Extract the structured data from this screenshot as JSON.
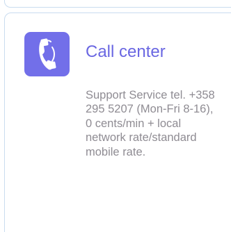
{
  "card": {
    "icon": "phone-handset-icon",
    "title": "Call center",
    "description_lines": [
      "Support Service tel. +358",
      "295 5207 (Mon-Fri 8-16),",
      "0 cents/min + local",
      "network rate/standard",
      "mobile rate."
    ]
  },
  "colors": {
    "accent": "#726fe9",
    "title": "#6a67e2",
    "body_text": "#8f8c93",
    "card_border": "#c9dcef"
  }
}
